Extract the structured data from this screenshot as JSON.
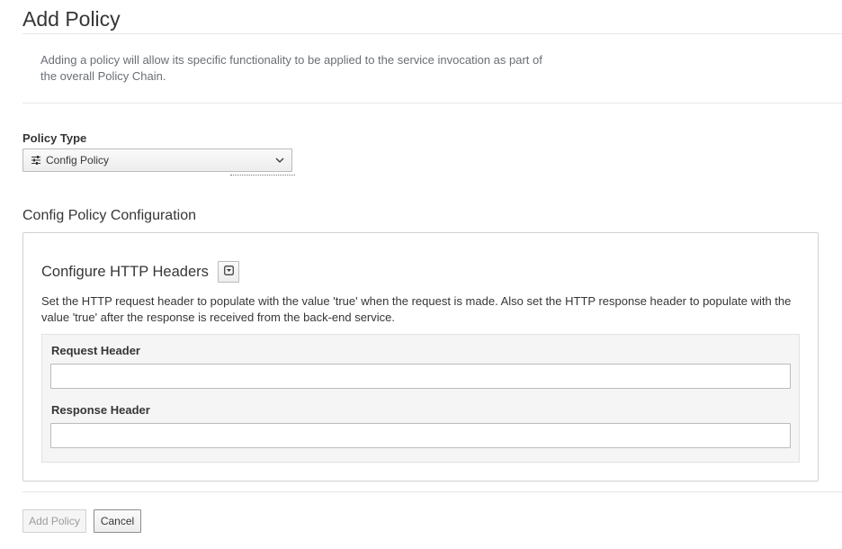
{
  "page": {
    "title": "Add Policy",
    "intro": "Adding a policy will allow its specific functionality to be applied to the service invocation as part of the overall Policy Chain."
  },
  "policy_type": {
    "label": "Policy Type",
    "selected": "Config Policy",
    "icon": "sliders-icon"
  },
  "config": {
    "section_title": "Config Policy Configuration",
    "panel": {
      "heading": "Configure HTTP Headers",
      "description": "Set the HTTP request header to populate with the value 'true' when the request is made. Also set the HTTP response header to populate with the value 'true' after the response is received from the back-end service.",
      "request_header_label": "Request Header",
      "request_header_value": "",
      "response_header_label": "Response Header",
      "response_header_value": ""
    }
  },
  "actions": {
    "add_label": "Add Policy",
    "cancel_label": "Cancel"
  }
}
